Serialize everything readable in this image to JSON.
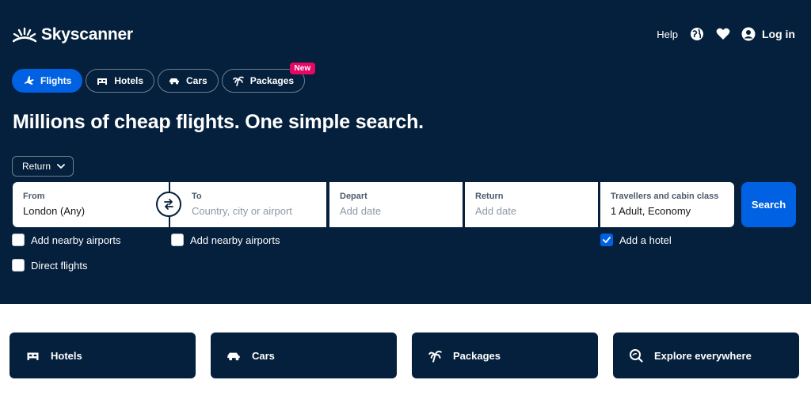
{
  "colors": {
    "hero_bg": "#05203c",
    "accent": "#0062e3",
    "badge": "#e70866"
  },
  "header": {
    "logo_text": "Skyscanner",
    "logo_icon": "sunrise-icon",
    "help_label": "Help",
    "globe_icon": "globe-icon",
    "favourites_icon": "heart-icon",
    "login_icon": "account-icon",
    "login_label": "Log in"
  },
  "tabs": [
    {
      "label": "Flights",
      "icon": "plane-icon",
      "active": true
    },
    {
      "label": "Hotels",
      "icon": "bed-icon",
      "active": false
    },
    {
      "label": "Cars",
      "icon": "car-icon",
      "active": false
    },
    {
      "label": "Packages",
      "icon": "palm-tree-icon",
      "active": false,
      "badge": "New"
    }
  ],
  "headline": "Millions of cheap flights. One simple search.",
  "trip_type": {
    "selected": "Return"
  },
  "search": {
    "from": {
      "label": "From",
      "value": "London (Any)"
    },
    "to": {
      "label": "To",
      "placeholder": "Country, city or airport"
    },
    "depart": {
      "label": "Depart",
      "placeholder": "Add date"
    },
    "return": {
      "label": "Return",
      "placeholder": "Add date"
    },
    "travellers": {
      "label": "Travellers and cabin class",
      "value": "1 Adult, Economy"
    },
    "button_label": "Search"
  },
  "options": {
    "nearby_from": {
      "label": "Add nearby airports",
      "checked": false
    },
    "nearby_to": {
      "label": "Add nearby airports",
      "checked": false
    },
    "add_hotel": {
      "label": "Add a hotel",
      "checked": true
    },
    "direct": {
      "label": "Direct flights",
      "checked": false
    }
  },
  "cards": [
    {
      "label": "Hotels",
      "icon": "bed-icon"
    },
    {
      "label": "Cars",
      "icon": "car-icon"
    },
    {
      "label": "Packages",
      "icon": "palm-tree-icon"
    },
    {
      "label": "Explore everywhere",
      "icon": "explore-icon"
    }
  ]
}
